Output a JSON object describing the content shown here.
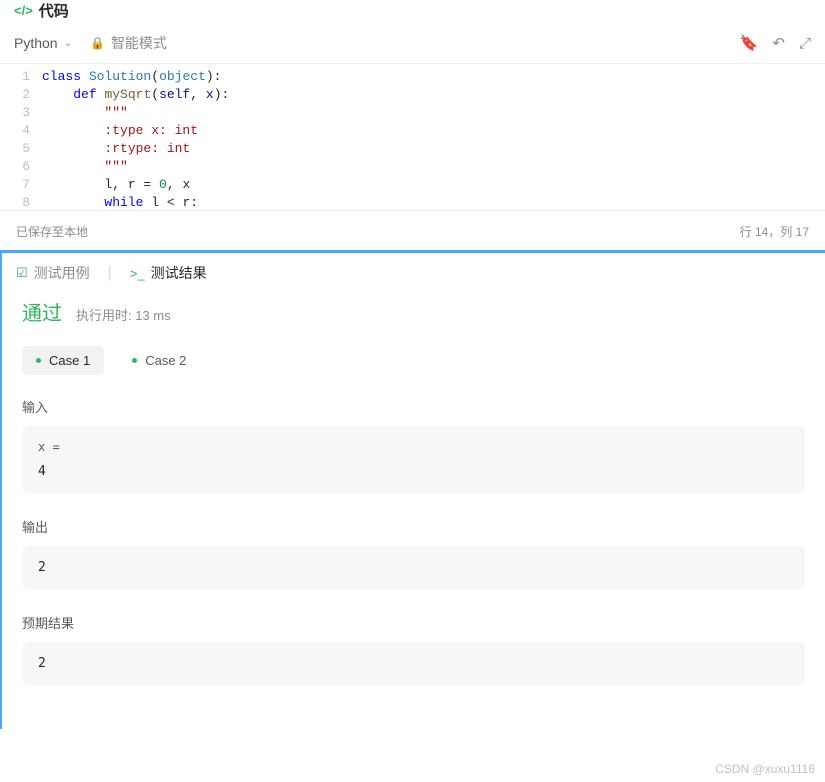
{
  "header": {
    "title": "代码"
  },
  "toolbar": {
    "language": "Python",
    "mode": "智能模式"
  },
  "editor": {
    "lines": [
      {
        "n": "1"
      },
      {
        "n": "2"
      },
      {
        "n": "3"
      },
      {
        "n": "4"
      },
      {
        "n": "5"
      },
      {
        "n": "6"
      },
      {
        "n": "7"
      },
      {
        "n": "8"
      }
    ],
    "code": {
      "cls_kw": "class",
      "cls_name": "Solution",
      "obj": "object",
      "def_kw": "def",
      "fn_name": "mySqrt",
      "self": "self",
      "x": "x",
      "doc1": "\"\"\"",
      "doc2": ":type x: int",
      "doc3": ":rtype: int",
      "doc4": "\"\"\"",
      "line7_a": "l, r = ",
      "line7_b": "0",
      "line7_c": ", x",
      "line8_a": "while",
      "line8_b": " l < r:"
    }
  },
  "status": {
    "saved": "已保存至本地",
    "pos": "行 14，列 17"
  },
  "tabs": {
    "tab1": "测试用例",
    "tab2": "测试结果"
  },
  "result": {
    "pass": "通过",
    "runtime": "执行用时: 13 ms",
    "case1": "Case 1",
    "case2": "Case 2",
    "input_label": "输入",
    "input_var": "x =",
    "input_val": "4",
    "output_label": "输出",
    "output_val": "2",
    "expected_label": "预期结果",
    "expected_val": "2"
  },
  "watermark": "CSDN @xuxu1116"
}
